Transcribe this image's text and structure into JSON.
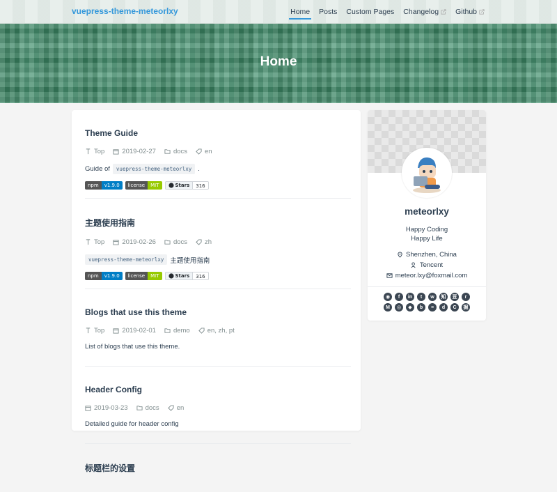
{
  "navbar": {
    "brand": "vuepress-theme-meteorlxy",
    "links": [
      {
        "label": "Home",
        "active": true,
        "external": false
      },
      {
        "label": "Posts",
        "active": false,
        "external": false
      },
      {
        "label": "Custom Pages",
        "active": false,
        "external": false
      },
      {
        "label": "Changelog",
        "active": false,
        "external": true
      },
      {
        "label": "Github",
        "active": false,
        "external": true
      }
    ]
  },
  "hero": {
    "title": "Home"
  },
  "posts": [
    {
      "title": "Theme Guide",
      "top": "Top",
      "date": "2019-02-27",
      "category": "docs",
      "tags": "en",
      "summary_before": "Guide of",
      "summary_code": "vuepress-theme-meteorlxy",
      "summary_after": ".",
      "badges": true
    },
    {
      "title": "主题使用指南",
      "top": "Top",
      "date": "2019-02-26",
      "category": "docs",
      "tags": "zh",
      "summary_before": "",
      "summary_code": "vuepress-theme-meteorlxy",
      "summary_after": "主题使用指南",
      "badges": true
    },
    {
      "title": "Blogs that use this theme",
      "top": "Top",
      "date": "2019-02-01",
      "category": "demo",
      "tags": "en, zh, pt",
      "summary": "List of blogs that use this theme."
    },
    {
      "title": "Header Config",
      "date": "2019-03-23",
      "category": "docs",
      "tags": "en",
      "summary": "Detailed guide for header config"
    },
    {
      "title": "标题栏的设置"
    }
  ],
  "badges": {
    "npm_label": "npm",
    "npm_value": "v1.9.0",
    "npm_color": "#007ec6",
    "license_label": "license",
    "license_value": "MIT",
    "license_color": "#97ca00",
    "stars_label": "Stars",
    "stars_value": "316"
  },
  "profile": {
    "name": "meteorlxy",
    "description_line1": "Happy Coding",
    "description_line2": "Happy Life",
    "location": "Shenzhen, China",
    "organization": "Tencent",
    "email": "meteor.lxy@foxmail.com",
    "social_icons": [
      "github-icon",
      "facebook-icon",
      "linkedin-icon",
      "twitter-icon",
      "weibo-icon",
      "zhihu-icon",
      "douban-icon",
      "reddit-icon",
      "medium-icon",
      "instagram-icon",
      "gitlab-icon",
      "bitbucket-icon",
      "stackoverflow-icon",
      "docker-hub-icon",
      "csdn-icon",
      "juejin-icon",
      "codepen-icon"
    ]
  },
  "colors": {
    "accent": "#3498db",
    "hero_green": "#3f8f6c",
    "text": "#2c3e50",
    "muted": "#7f8c8d"
  }
}
